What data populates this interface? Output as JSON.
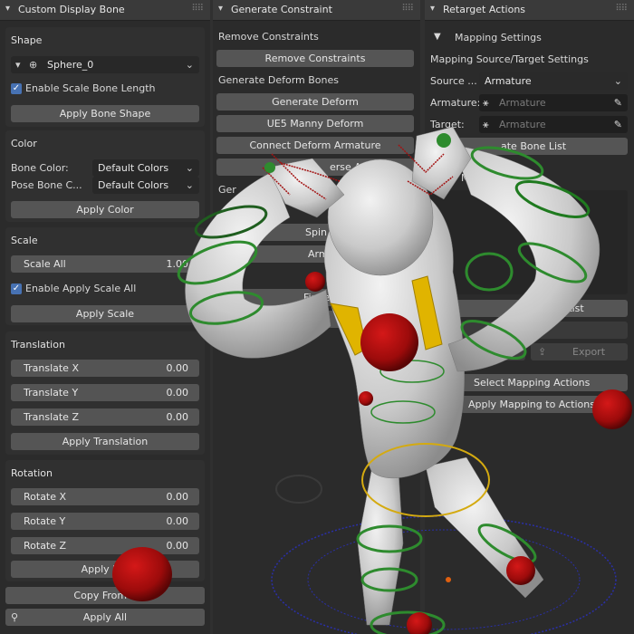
{
  "panel1": {
    "title": "Custom Display Bone",
    "shape": {
      "title": "Shape",
      "shape_value": "Sphere_0",
      "scale_length_label": "Enable Scale Bone Length",
      "apply_label": "Apply Bone Shape"
    },
    "color": {
      "title": "Color",
      "bone_color_label": "Bone Color:",
      "bone_color_value": "Default Colors",
      "pose_color_label": "Pose Bone C...",
      "pose_color_value": "Default Colors",
      "apply_label": "Apply Color"
    },
    "scale": {
      "title": "Scale",
      "scale_all_label": "Scale All",
      "scale_all_value": "1.00",
      "enable_label": "Enable Apply Scale All",
      "apply_label": "Apply Scale"
    },
    "translation": {
      "title": "Translation",
      "x_label": "Translate X",
      "x_value": "0.00",
      "y_label": "Translate Y",
      "y_value": "0.00",
      "z_label": "Translate Z",
      "z_value": "0.00",
      "apply_label": "Apply Translation"
    },
    "rotation": {
      "title": "Rotation",
      "x_label": "Rotate X",
      "x_value": "0.00",
      "y_label": "Rotate Y",
      "y_value": "0.00",
      "z_label": "Rotate Z",
      "z_value": "0.00",
      "apply_label": "Apply Rot"
    },
    "copy_label": "Copy From S",
    "apply_all_label": "Apply All"
  },
  "panel2": {
    "title": "Generate Constraint",
    "remove_section": "Remove Constraints",
    "remove_button": "Remove Constraints",
    "deform_section": "Generate Deform Bones",
    "generate_deform": "Generate Deform",
    "ue5_manny": "UE5 Manny Deform",
    "connect_deform": "Connect Deform Armature",
    "reverse_all": "erse All",
    "gen_label": "Ger",
    "spin": "Spin",
    "arm": "Arm",
    "finger": "Finger",
    "ue5_m": "UE5 M"
  },
  "panel3": {
    "title": "Retarget Actions",
    "mapping_settings": "Mapping Settings",
    "source_target": "Mapping Source/Target Settings",
    "source_label": "Source ...",
    "source_value": "Armature",
    "armature_label": "Armature:",
    "armature_placeholder": "Armature",
    "target_label": "Target:",
    "target_placeholder": "Armature",
    "bone_list": "ate Bone List",
    "map_label": "M",
    "mapping_list": "ping List",
    "import_label": "mport",
    "export_label": "Export",
    "select_mapping": "Select Mapping Actions",
    "apply_mapping": "Apply Mapping to Actions"
  },
  "colors": {
    "accent": "#4772b3",
    "red_sphere": "#a30e0e",
    "green_ring": "#2e8b2e",
    "yellow": "#e0b400"
  }
}
